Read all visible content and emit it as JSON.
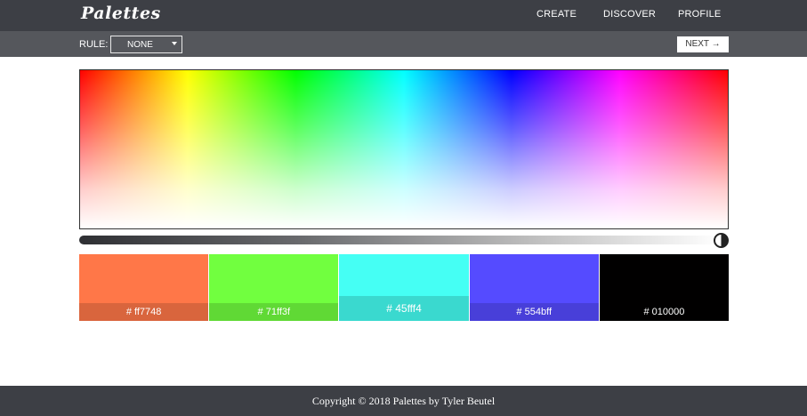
{
  "app": {
    "logo": "Palettes"
  },
  "nav": {
    "items": [
      {
        "label": "CREATE"
      },
      {
        "label": "DISCOVER"
      },
      {
        "label": "PROFILE"
      }
    ]
  },
  "rulebar": {
    "label": "RULE:",
    "rule_value": "NONE",
    "next_label": "NEXT →"
  },
  "brightness": {
    "level": 0.98
  },
  "swatches": [
    {
      "color": "#ff7748",
      "label_prefix": "#",
      "label_code": "ff7748"
    },
    {
      "color": "#71ff3f",
      "label_prefix": "#",
      "label_code": "71ff3f"
    },
    {
      "color": "#45fff4",
      "label_prefix": "#",
      "label_code": "45fff4"
    },
    {
      "color": "#554bff",
      "label_prefix": "#",
      "label_code": "554bff"
    },
    {
      "color": "#010000",
      "label_prefix": "#",
      "label_code": "010000"
    }
  ],
  "footer": {
    "text": "Copyright © 2018 Palettes by Tyler Beutel"
  }
}
